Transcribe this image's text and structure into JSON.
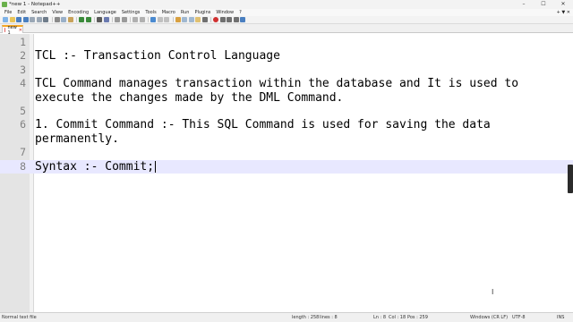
{
  "window": {
    "title": "*new 1 - Notepad++",
    "buttons": {
      "minimize": "–",
      "maximize": "☐",
      "close": "✕"
    }
  },
  "menu": {
    "items": [
      "File",
      "Edit",
      "Search",
      "View",
      "Encoding",
      "Language",
      "Settings",
      "Tools",
      "Macro",
      "Run",
      "Plugins",
      "Window",
      "?"
    ],
    "right": "+ ▼ ✕"
  },
  "toolbar": {
    "icons": [
      "new-icon",
      "open-icon",
      "save-icon",
      "save-all-icon",
      "close-icon",
      "close-all-icon",
      "print-icon",
      "cut-icon",
      "copy-icon",
      "paste-icon",
      "undo-icon",
      "redo-icon",
      "find-icon",
      "replace-icon",
      "zoom-in-icon",
      "zoom-out-icon",
      "sync-v-icon",
      "sync-h-icon",
      "word-wrap-icon",
      "all-chars-icon",
      "indent-guide-icon",
      "udl-icon",
      "doc-map-icon",
      "function-list-icon",
      "folder-workspace-icon",
      "monitor-icon",
      "record-macro-icon",
      "stop-macro-icon",
      "play-macro-icon",
      "run-macro-multiple-icon",
      "save-macro-icon"
    ]
  },
  "tab": {
    "label": "new 1",
    "close": "✕"
  },
  "editor": {
    "lines": [
      {
        "num": "1",
        "text": ""
      },
      {
        "num": "2",
        "text": "TCL :- Transaction Control Language"
      },
      {
        "num": "3",
        "text": ""
      },
      {
        "num": "4",
        "text": "TCL Command manages transaction within the database and It is used to"
      },
      {
        "num": "",
        "text": "execute the changes made by the DML Command."
      },
      {
        "num": "5",
        "text": ""
      },
      {
        "num": "6",
        "text": "1. Commit Command :- This SQL Command is used for saving the data"
      },
      {
        "num": "",
        "text": "permanently."
      },
      {
        "num": "7",
        "text": ""
      },
      {
        "num": "8",
        "text": "Syntax :- Commit;"
      }
    ],
    "current_line_index": 9
  },
  "status": {
    "file_type": "Normal text file",
    "length": "length : 258",
    "lines": "lines : 8",
    "ln": "Ln : 8",
    "col": "Col : 18",
    "pos": "Pos : 259",
    "eol": "Windows (CR LF)",
    "encoding": "UTF-8",
    "mode": "INS"
  },
  "colors": {
    "accent_tab": "#f5a623",
    "current_line": "#e8e8ff",
    "gutter": "#e4e4e4"
  }
}
